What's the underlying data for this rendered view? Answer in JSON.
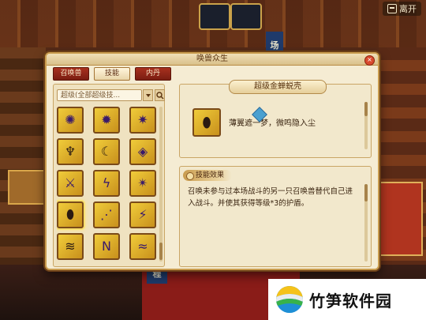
{
  "top_bar": {
    "leave_label": "离开"
  },
  "scene": {
    "sign_top": "场",
    "sign_bottom": "程"
  },
  "dialog": {
    "title": "唤兽众生",
    "close_icon": "close-icon",
    "tabs": [
      {
        "label": "召唤兽",
        "active": false
      },
      {
        "label": "技能",
        "active": true
      },
      {
        "label": "内丹",
        "active": false
      }
    ],
    "filter": {
      "value": "超级(全部超级技..."
    },
    "skills": [
      {
        "icon": "sun-rune-icon",
        "glyph": "✺",
        "tone": "p"
      },
      {
        "icon": "sun-rune-icon",
        "glyph": "✹",
        "tone": "p"
      },
      {
        "icon": "sun-rune-icon",
        "glyph": "✷",
        "tone": "p"
      },
      {
        "icon": "fan-icon",
        "glyph": "♆",
        "tone": "d"
      },
      {
        "icon": "crescent-icon",
        "glyph": "☾",
        "tone": "d"
      },
      {
        "icon": "shield-icon",
        "glyph": "◈",
        "tone": "p"
      },
      {
        "icon": "sword-icon",
        "glyph": "⚔",
        "tone": "p"
      },
      {
        "icon": "lightning-icon",
        "glyph": "ϟ",
        "tone": "p"
      },
      {
        "icon": "vortex-icon",
        "glyph": "✴",
        "tone": "p"
      },
      {
        "icon": "shell-icon",
        "glyph": "⬮",
        "tone": "d",
        "selected": true
      },
      {
        "icon": "claw-icon",
        "glyph": "⋰",
        "tone": "p"
      },
      {
        "icon": "burst-icon",
        "glyph": "⚡",
        "tone": "p"
      },
      {
        "icon": "wind-icon",
        "glyph": "≋",
        "tone": "d"
      },
      {
        "icon": "rune-n-icon",
        "glyph": "N",
        "tone": "p"
      },
      {
        "icon": "wave-icon",
        "glyph": "≈",
        "tone": "p"
      },
      {
        "icon": "ring-icon",
        "glyph": "◎",
        "tone": "p"
      },
      {
        "icon": "rune-icon",
        "glyph": "⌘",
        "tone": "p"
      },
      {
        "icon": "star-icon",
        "glyph": "✦",
        "tone": "p"
      }
    ],
    "selected_skill": {
      "name": "超级金蝉蜕壳",
      "icon": "shell-icon",
      "glyph": "⬮",
      "short_desc": "薄翼遮一梦，微鸣隐入尘"
    },
    "effect": {
      "title": "技能效果",
      "text": "召唤未参与过本场战斗的另一只召唤兽替代自己进入战斗。并使其获得等级*3的护盾。"
    }
  },
  "watermark": {
    "text": "竹笋软件园"
  }
}
